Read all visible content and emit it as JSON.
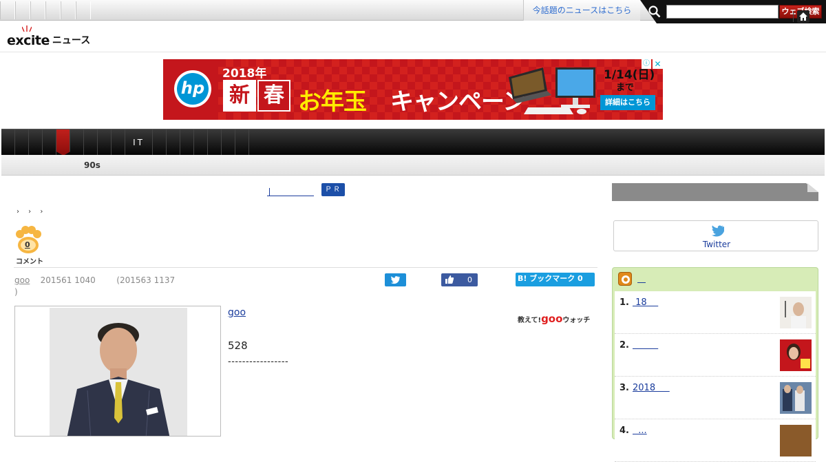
{
  "topbar": {
    "trend_link": "今話題のニュースはこちら",
    "search_placeholder": "",
    "search_button": "ウェブ検索"
  },
  "header": {
    "logo_brand": "excite",
    "logo_section": "ニュース"
  },
  "ad": {
    "year": "2018年",
    "shin": "新",
    "haru": "春",
    "otoshidama": "お年玉",
    "campaign": "キャンペーン",
    "brand": "hp",
    "date": "1/14(日)",
    "made": "まで",
    "cta": "詳細はこちら",
    "info_glyph": "ⓘ",
    "close_glyph": "✕"
  },
  "nav": {
    "it_tab": "IT",
    "subnav_item": "90s"
  },
  "article": {
    "pr_badge": "ＰＲ",
    "breadcrumb": "› › ›",
    "comment_count": "0",
    "comment_label": "コメント",
    "byline_source": "goo",
    "byline_date": "201561 1040",
    "byline_updated": "(201563 1137",
    "byline_close": ")",
    "fb_count": "0",
    "hatena_label": "B! ブックマーク 0",
    "link_text": "goo",
    "goo_prefix": "教えて!",
    "goo_brand": "goo",
    "goo_suffix": "ウォッチ",
    "body_number": "528",
    "body_dashes": "-----------------"
  },
  "sidebar": {
    "twitter_label": "Twitter",
    "ranking_items": [
      {
        "rank": "1.",
        "title": " 18    "
      },
      {
        "rank": "2.",
        "title": "         "
      },
      {
        "rank": "3.",
        "title": "2018     "
      },
      {
        "rank": "4.",
        "title": "  ..."
      }
    ]
  },
  "colors": {
    "brand_red": "#c4161c",
    "link_blue": "#1a3c9c",
    "hp_blue": "#0096d6",
    "ranking_green": "#d7ecb7"
  }
}
